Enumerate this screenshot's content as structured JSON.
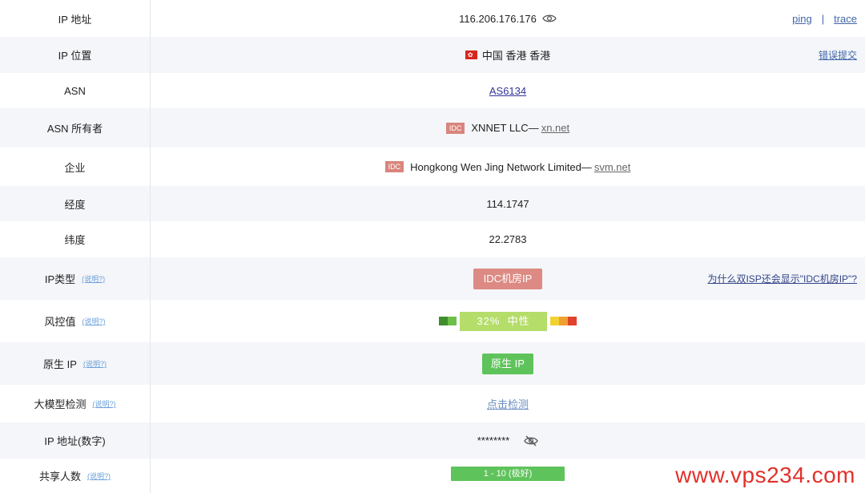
{
  "rows": {
    "ip": {
      "label": "IP 地址",
      "value": "116.206.176.176",
      "ping": "ping",
      "divider": "|",
      "trace": "trace"
    },
    "location": {
      "label": "IP 位置",
      "value": "中国 香港 香港",
      "report": "错误提交"
    },
    "asn": {
      "label": "ASN",
      "value": "AS6134"
    },
    "asn_owner": {
      "label": "ASN 所有者",
      "tag": "IDC",
      "name": "XNNET LLC—",
      "domain": "xn.net"
    },
    "company": {
      "label": "企业",
      "tag": "IDC",
      "name": "Hongkong Wen Jing Network Limited—",
      "domain": "svm.net"
    },
    "longitude": {
      "label": "经度",
      "value": "114.1747"
    },
    "latitude": {
      "label": "纬度",
      "value": "22.2783"
    },
    "ip_type": {
      "label": "IP类型",
      "help": "(说明?)",
      "badge": "IDC机房IP",
      "question": "为什么双ISP还会显示\"IDC机房IP\"?"
    },
    "risk": {
      "label": "风控值",
      "help": "(说明?)",
      "score": "32%",
      "level": "中性",
      "colors_left": [
        "#3e8e2e",
        "#6cc04a"
      ],
      "color_mid": "#b5dd6a",
      "colors_right": [
        "#f2d233",
        "#f0a030",
        "#e0432b"
      ]
    },
    "native": {
      "label": "原生 IP",
      "help": "(说明?)",
      "badge": "原生 IP"
    },
    "llm": {
      "label": "大模型检测",
      "help": "(说明?)",
      "action": "点击检测"
    },
    "ip_numeric": {
      "label": "IP 地址(数字)",
      "masked": "********",
      "icon": "eye-off-icon"
    },
    "shared": {
      "label": "共享人数",
      "help": "(说明?)",
      "value": "1 - 10 (极好)"
    }
  },
  "watermark": "www.vps234.com"
}
